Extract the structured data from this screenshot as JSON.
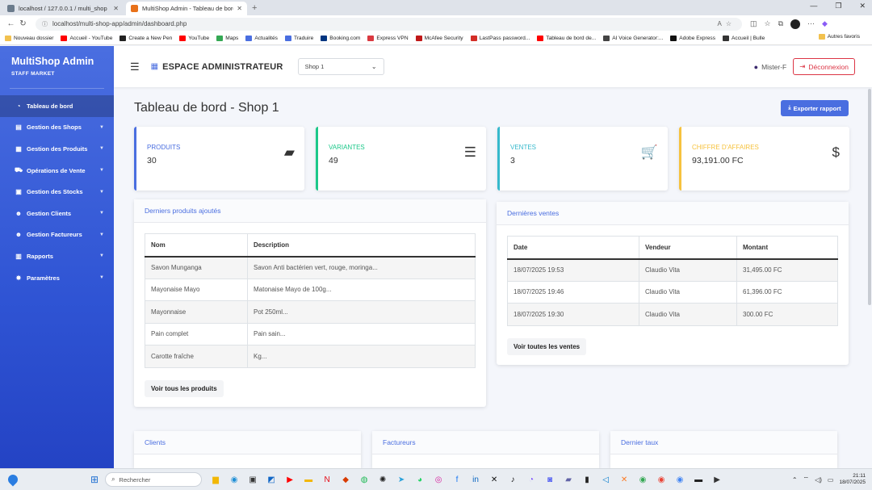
{
  "browser": {
    "tabs": [
      {
        "label": "localhost / 127.0.0.1 / multi_shop",
        "color": "#6b7b8c",
        "active": false
      },
      {
        "label": "MultiShop Admin - Tableau de bord",
        "color": "#e8711a",
        "active": true
      }
    ],
    "url": "localhost/multi-shop-app/admin/dashboard.php",
    "bookmarks": [
      {
        "label": "Nouveau dossier",
        "color": "#f2c14e"
      },
      {
        "label": "Accueil - YouTube",
        "color": "#ff0000"
      },
      {
        "label": "Create a New Pen",
        "color": "#222222"
      },
      {
        "label": "YouTube",
        "color": "#ff0000"
      },
      {
        "label": "Maps",
        "color": "#34a853"
      },
      {
        "label": "Actualités",
        "color": "#4a6ee0"
      },
      {
        "label": "Traduire",
        "color": "#4a6ee0"
      },
      {
        "label": "Booking.com",
        "color": "#003580"
      },
      {
        "label": "Express VPN",
        "color": "#da3940"
      },
      {
        "label": "McAfee Security",
        "color": "#c01818"
      },
      {
        "label": "LastPass password...",
        "color": "#d32d27"
      },
      {
        "label": "Tableau de bord de...",
        "color": "#ff0000"
      },
      {
        "label": "AI Voice Generator:...",
        "color": "#444444"
      },
      {
        "label": "Adobe Express",
        "color": "#111111"
      },
      {
        "label": "Accueil | Bulle",
        "color": "#333333"
      }
    ],
    "more_bookmarks": "Autres favoris"
  },
  "sidebar": {
    "brand": "MultiShop Admin",
    "subtitle": "STAFF MARKET",
    "items": [
      {
        "label": "Tableau de bord",
        "icon": "dashboard-icon",
        "glyph": "◔",
        "active": true,
        "caret": false
      },
      {
        "label": "Gestion des Shops",
        "icon": "store-icon",
        "glyph": "▤",
        "active": false,
        "caret": true
      },
      {
        "label": "Gestion des Produits",
        "icon": "boxes-icon",
        "glyph": "▦",
        "active": false,
        "caret": true
      },
      {
        "label": "Opérations de Vente",
        "icon": "cart-icon",
        "glyph": "⛟",
        "active": false,
        "caret": true
      },
      {
        "label": "Gestion des Stocks",
        "icon": "warehouse-icon",
        "glyph": "▣",
        "active": false,
        "caret": true
      },
      {
        "label": "Gestion Clients",
        "icon": "users-icon",
        "glyph": "☻",
        "active": false,
        "caret": true
      },
      {
        "label": "Gestion Factureurs",
        "icon": "user-tie-icon",
        "glyph": "☻",
        "active": false,
        "caret": true
      },
      {
        "label": "Rapports",
        "icon": "chart-icon",
        "glyph": "▥",
        "active": false,
        "caret": true
      },
      {
        "label": "Paramètres",
        "icon": "gear-icon",
        "glyph": "✸",
        "active": false,
        "caret": true
      }
    ]
  },
  "header": {
    "title": "ESPACE ADMINISTRATEUR",
    "shop_selected": "Shop 1",
    "user": "Mister-F",
    "logout": "Déconnexion"
  },
  "main": {
    "page_title": "Tableau de bord - Shop 1",
    "export_label": "Exporter rapport",
    "stats": [
      {
        "label": "PRODUITS",
        "value": "30",
        "color": "#4a6ee0",
        "icon": "box-icon",
        "glyph": "▰"
      },
      {
        "label": "VARIANTES",
        "value": "49",
        "color": "#1cc88a",
        "icon": "list-icon",
        "glyph": "☰"
      },
      {
        "label": "VENTES",
        "value": "3",
        "color": "#36b9cc",
        "icon": "cart-icon",
        "glyph": "🛒"
      },
      {
        "label": "CHIFFRE D'AFFAIRES",
        "value": "93,191.00 FC",
        "color": "#f6c23e",
        "icon": "dollar-icon",
        "glyph": "$"
      }
    ],
    "products_card": {
      "title": "Derniers produits ajoutés",
      "columns": [
        "Nom",
        "Description"
      ],
      "rows": [
        [
          "Savon Munganga",
          "Savon Anti bactérien vert, rouge, moringa..."
        ],
        [
          "Mayonaise Mayo",
          "Matonaise Mayo de 100g..."
        ],
        [
          "Mayonnaise",
          "Pot 250ml..."
        ],
        [
          "Pain complet",
          "Pain sain..."
        ],
        [
          "Carotte fraîche",
          "Kg..."
        ]
      ],
      "button": "Voir tous les produits"
    },
    "sales_card": {
      "title": "Dernières ventes",
      "columns": [
        "Date",
        "Vendeur",
        "Montant"
      ],
      "rows": [
        [
          "18/07/2025 19:53",
          "Claudio Vita",
          "31,495.00 FC"
        ],
        [
          "18/07/2025 19:46",
          "Claudio Vita",
          "61,396.00 FC"
        ],
        [
          "18/07/2025 19:30",
          "Claudio Vita",
          "300.00 FC"
        ]
      ],
      "button": "Voir toutes les ventes"
    },
    "bottom_cards": [
      "Clients",
      "Factureurs",
      "Dernier taux"
    ]
  },
  "taskbar": {
    "search_placeholder": "Rechercher",
    "time": "21:11",
    "date": "18/07/2025",
    "apps": [
      {
        "name": "file-explorer-icon",
        "glyph": "▆",
        "color": "#f2b705"
      },
      {
        "name": "edge-icon",
        "glyph": "◉",
        "color": "#1f8fd6"
      },
      {
        "name": "store-icon",
        "glyph": "▣",
        "color": "#333333"
      },
      {
        "name": "outlook-icon",
        "glyph": "◩",
        "color": "#1066c6"
      },
      {
        "name": "youtube-icon",
        "glyph": "▶",
        "color": "#ff0000"
      },
      {
        "name": "folder-icon",
        "glyph": "▬",
        "color": "#f2b705"
      },
      {
        "name": "netflix-icon",
        "glyph": "N",
        "color": "#e50914"
      },
      {
        "name": "office-icon",
        "glyph": "◆",
        "color": "#d83b01"
      },
      {
        "name": "spotify-icon",
        "glyph": "◍",
        "color": "#1db954"
      },
      {
        "name": "chatgpt-icon",
        "glyph": "✺",
        "color": "#222222"
      },
      {
        "name": "telegram-icon",
        "glyph": "➤",
        "color": "#2aa1da"
      },
      {
        "name": "whatsapp-icon",
        "glyph": "◕",
        "color": "#25d366"
      },
      {
        "name": "instagram-icon",
        "glyph": "◎",
        "color": "#d6249f"
      },
      {
        "name": "facebook-icon",
        "glyph": "f",
        "color": "#1877f2"
      },
      {
        "name": "linkedin-icon",
        "glyph": "in",
        "color": "#0a66c2"
      },
      {
        "name": "x-icon",
        "glyph": "✕",
        "color": "#111111"
      },
      {
        "name": "tiktok-icon",
        "glyph": "♪",
        "color": "#111111"
      },
      {
        "name": "messenger-icon",
        "glyph": "◔",
        "color": "#7b4dff"
      },
      {
        "name": "discord-icon",
        "glyph": "◙",
        "color": "#5865f2"
      },
      {
        "name": "teams-icon",
        "glyph": "▰",
        "color": "#6264a7"
      },
      {
        "name": "terminal-icon",
        "glyph": "▮",
        "color": "#222222"
      },
      {
        "name": "vscode-icon",
        "glyph": "◁",
        "color": "#007acc"
      },
      {
        "name": "xampp-icon",
        "glyph": "✕",
        "color": "#fb7a24"
      },
      {
        "name": "chrome-icon",
        "glyph": "◉",
        "color": "#34a853"
      },
      {
        "name": "chrome-profile-icon",
        "glyph": "◉",
        "color": "#ea4335"
      },
      {
        "name": "chrome-dev-icon",
        "glyph": "◉",
        "color": "#4285f4"
      },
      {
        "name": "cmd-icon",
        "glyph": "▬",
        "color": "#222222"
      },
      {
        "name": "media-icon",
        "glyph": "▶",
        "color": "#333333"
      }
    ]
  }
}
